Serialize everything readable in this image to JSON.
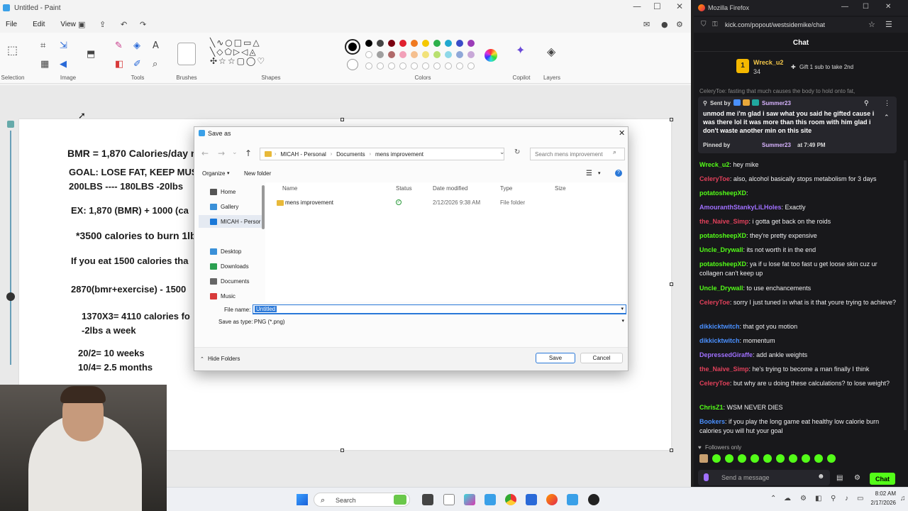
{
  "paint": {
    "title": "Untitled - Paint",
    "menu": [
      "File",
      "Edit",
      "View"
    ],
    "ribbon_groups": [
      "Selection",
      "Image",
      "Tools",
      "Brushes",
      "Shapes",
      "Colors",
      "Copilot",
      "Layers"
    ],
    "palette_colors": [
      "#000000",
      "#444444",
      "#7a0010",
      "#e0202e",
      "#f07a20",
      "#f5c800",
      "#2db04b",
      "#20a8d0",
      "#3a4cc8",
      "#9b3cb8"
    ],
    "palette_colors_2": [
      "#ffffff",
      "#a0a0a0",
      "#b06a6a",
      "#f2a0b8",
      "#f5c090",
      "#f2e27a",
      "#b8e070",
      "#8ed8e8",
      "#8fa8d8",
      "#c8a8d8"
    ],
    "notes": [
      {
        "text": "BMR = 1,870 Calories/day n",
        "color": "#1a1a1a"
      },
      {
        "text": "GOAL: LOSE FAT, KEEP MUS",
        "color": "#c8102e"
      },
      {
        "text": "200LBS ---- 180LBS    -20lbs",
        "color": "#c8102e"
      },
      {
        "text": "EX: 1,870 (BMR) + 1000 (ca",
        "color": "#3a55c8"
      },
      {
        "text": "*3500 calories to burn 1lb",
        "color": "#1a1a1a"
      },
      {
        "text": "If you eat 1500 calories tha",
        "color": "#1ea8d8"
      },
      {
        "text": "2870(bmr+exercise) - 1500",
        "color": "#5a3aa8"
      },
      {
        "text": "1370X3= 4110 calories fo",
        "color": "#1a1a1a"
      },
      {
        "text": "-2lbs a week",
        "color": "#1a1a1a"
      },
      {
        "text": "20/2= 10 weeks",
        "color": "#1a1a1a"
      },
      {
        "text": "10/4= 2.5 months",
        "color": "#1a1a1a"
      }
    ]
  },
  "dialog": {
    "title": "Save as",
    "breadcrumb": [
      "MICAH - Personal",
      "Documents",
      "mens improvement"
    ],
    "search_placeholder": "Search mens improvement",
    "organize": "Organize",
    "new_folder": "New folder",
    "nav_items": [
      "Home",
      "Gallery",
      "MICAH - Persor",
      "Desktop",
      "Downloads",
      "Documents",
      "Music"
    ],
    "columns": [
      "Name",
      "Status",
      "Date modified",
      "Type",
      "Size"
    ],
    "files": [
      {
        "name": "mens improvement",
        "date": "2/12/2026 9:38 AM",
        "type": "File folder"
      }
    ],
    "file_name_label": "File name:",
    "file_name_value": "Untitled",
    "save_type_label": "Save as type:",
    "save_type_value": "PNG (*.png)",
    "hide_folders": "Hide Folders",
    "save": "Save",
    "cancel": "Cancel"
  },
  "firefox": {
    "title": "Mozilla Firefox",
    "url": "kick.com/popout/westsidemike/chat",
    "chat_header": "Chat",
    "gifter": {
      "name": "Wreck_u2",
      "count": "34",
      "message": "Gift 1 sub to take 2nd"
    },
    "truncated_line": "CeleryToe: fasting that much causes the body to hold onto fat,",
    "pinned": {
      "sent_by": "Sent by",
      "sender": "Summer23",
      "text": "unmod me i'm glad i saw what you said he gifted cause i was there lol it was more than this room with him glad i don't waste another min on this site",
      "pinned_by": "Pinned by",
      "pinner": "Summer23",
      "time": "at 7:49 PM"
    },
    "messages": [
      {
        "user": "Wreck_u2",
        "text": "hey mike",
        "color": "#53fc18"
      },
      {
        "user": "CeleryToe",
        "text": "also, alcohol basically stops metabolism for 3 days",
        "color": "#e0405a"
      },
      {
        "user": "potatosheepXD",
        "text": "",
        "color": "#53fc18"
      },
      {
        "user": "AmouranthStankyLiLHoles",
        "text": "Exactly",
        "color": "#a070ff"
      },
      {
        "user": "the_Naive_Simp",
        "text": "i gotta get back on the roids",
        "color": "#e0405a"
      },
      {
        "user": "potatosheepXD",
        "text": "they're pretty expensive",
        "color": "#53fc18"
      },
      {
        "user": "Uncle_Drywall",
        "text": "its not worth it in the end",
        "color": "#53fc18"
      },
      {
        "user": "potatosheepXD",
        "text": "ya if u lose fat too fast u get loose skin cuz ur collagen can't keep up",
        "color": "#53fc18"
      },
      {
        "user": "Uncle_Drywall",
        "text": "to use enchancements",
        "color": "#53fc18"
      },
      {
        "user": "CeleryToe",
        "text": "sorry I just tuned in what is it that youre trying to achieve?",
        "color": "#e0405a"
      },
      {
        "user": "dikkicktwitch",
        "text": "that got you motion",
        "color": "#4a90ff"
      },
      {
        "user": "dikkicktwitch",
        "text": "momentum",
        "color": "#4a90ff"
      },
      {
        "user": "DepressedGiraffe",
        "text": "add ankle weights",
        "color": "#a070ff"
      },
      {
        "user": "the_Naive_Simp",
        "text": "he's trying to become a man finally I think",
        "color": "#e0405a"
      },
      {
        "user": "CeleryToe",
        "text": "but why are u doing these calculations? to lose weight?",
        "color": "#e0405a"
      },
      {
        "user": "ChrisZ1",
        "text": "WSM NEVER DIES",
        "color": "#53fc18"
      },
      {
        "user": "Bookers",
        "text": "if you play the long game eat healthy low calorie burn calories you will hut your goal",
        "color": "#4a90ff"
      }
    ],
    "followers_only": "Followers only",
    "send_placeholder": "Send a message",
    "chat_button": "Chat"
  },
  "taskbar": {
    "search": "Search",
    "time": "8:02 AM",
    "date": "2/17/2026"
  }
}
